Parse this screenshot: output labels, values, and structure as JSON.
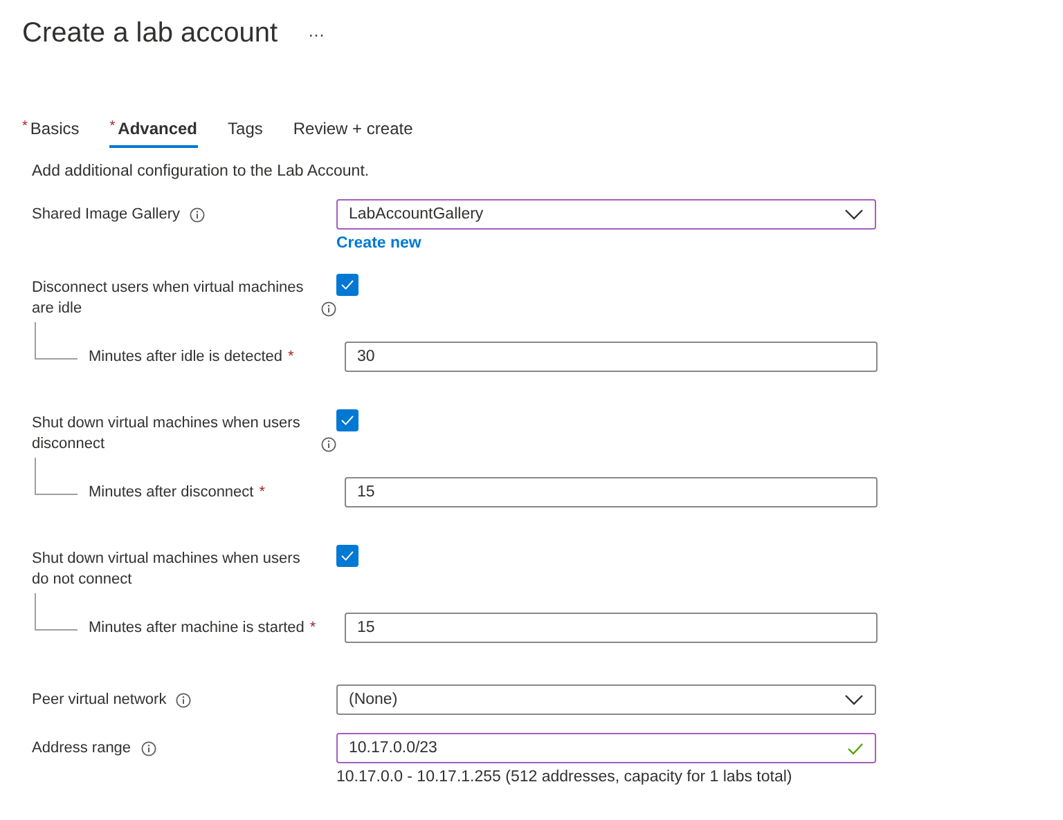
{
  "title": "Create a lab account",
  "more": "···",
  "tabs": [
    {
      "label": "Basics",
      "marker": "*",
      "selected": false
    },
    {
      "label": "Advanced",
      "marker": "*",
      "selected": true
    },
    {
      "label": "Tags",
      "selected": false
    },
    {
      "label": "Review + create",
      "selected": false
    }
  ],
  "description": "Add additional configuration to the Lab Account.",
  "fields": [
    {
      "kind": "dropdown",
      "label": "Shared Image Gallery",
      "info": true,
      "value": "LabAccountGallery",
      "focused": true,
      "link": "Create new"
    },
    {
      "kind": "checkbox",
      "label": "Disconnect users when virtual machines are idle",
      "info": true,
      "checked": true,
      "sub": {
        "label": "Minutes after idle is detected",
        "marker": "*",
        "value": "30"
      }
    },
    {
      "kind": "checkbox",
      "label": "Shut down virtual machines when users disconnect",
      "info": true,
      "checked": true,
      "sub": {
        "label": "Minutes after disconnect",
        "marker": "*",
        "value": "15"
      }
    },
    {
      "kind": "checkbox",
      "label": "Shut down virtual machines when users do not connect",
      "info": false,
      "checked": true,
      "sub": {
        "label": "Minutes after machine is started",
        "marker": "*",
        "value": "15"
      }
    },
    {
      "kind": "dropdown",
      "label": "Peer virtual network",
      "info": true,
      "value": "(None)",
      "focused": false
    },
    {
      "kind": "text",
      "label": "Address range",
      "info": true,
      "value": "10.17.0.0/23",
      "focused": true,
      "valid": true,
      "hint": "10.17.0.0 - 10.17.1.255 (512 addresses, capacity for 1 labs total)"
    }
  ]
}
